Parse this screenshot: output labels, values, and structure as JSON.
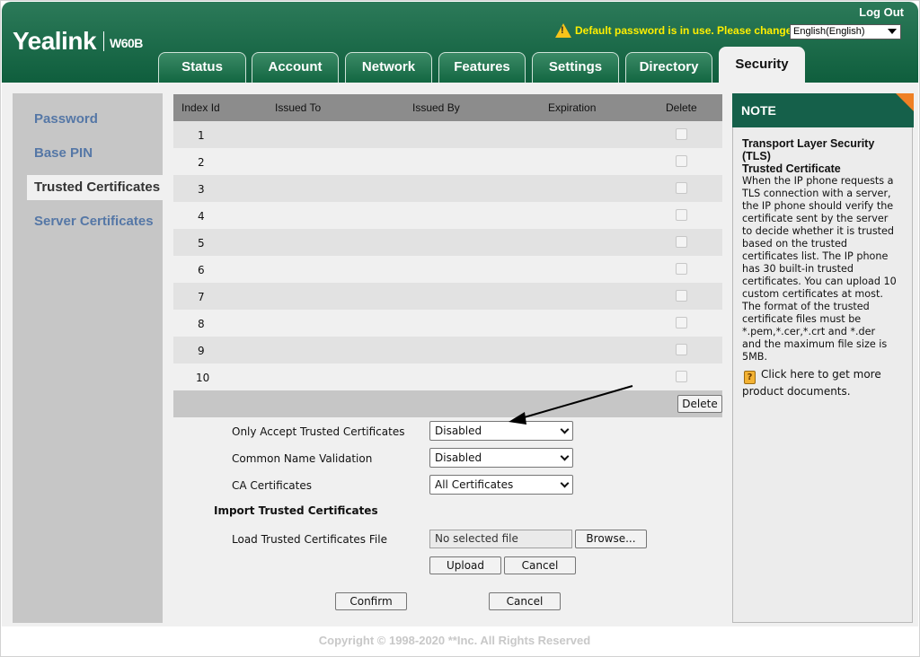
{
  "header": {
    "logo": "Yealink",
    "model": "W60B",
    "logout": "Log Out",
    "warning": "Default password is in use. Please change!",
    "language": "English(English)"
  },
  "tabs": [
    "Status",
    "Account",
    "Network",
    "Features",
    "Settings",
    "Directory",
    "Security"
  ],
  "active_tab": "Security",
  "sidebar": {
    "items": [
      "Password",
      "Base PIN",
      "Trusted Certificates",
      "Server Certificates"
    ],
    "active": "Trusted Certificates"
  },
  "cert_table": {
    "headers": [
      "Index Id",
      "Issued To",
      "Issued By",
      "Expiration",
      "Delete"
    ],
    "rows": [
      "1",
      "2",
      "3",
      "4",
      "5",
      "6",
      "7",
      "8",
      "9",
      "10"
    ],
    "delete_button": "Delete"
  },
  "settings": {
    "only_accept": {
      "label": "Only Accept Trusted Certificates",
      "value": "Disabled"
    },
    "common_name": {
      "label": "Common Name Validation",
      "value": "Disabled"
    },
    "ca_certs": {
      "label": "CA Certificates",
      "value": "All Certificates"
    },
    "import_title": "Import Trusted Certificates",
    "load_label": "Load Trusted Certificates File",
    "file_value": "No selected file",
    "browse": "Browse...",
    "upload": "Upload",
    "cancel_upload": "Cancel",
    "confirm": "Confirm",
    "cancel": "Cancel"
  },
  "note": {
    "heading": "NOTE",
    "title": "Transport Layer Security (TLS)",
    "subtitle": "Trusted Certificate",
    "body": "When the IP phone requests a TLS connection with a server, the IP phone should verify the certificate sent by the server to decide whether it is trusted based on the trusted certificates list. The IP phone has 30 built-in trusted certificates. You can upload 10 custom certificates at most. The format of the trusted certificate files must be *.pem,*.cer,*.crt and *.der and the maximum file size is 5MB.",
    "link": "Click here to get more product documents."
  },
  "copyright": "Copyright © 1998-2020 **Inc. All Rights Reserved",
  "colors": {
    "header_green": "#0f5e3d",
    "sidebar_link": "#5577a6",
    "warning_yellow": "#ffef00",
    "note_accent": "#ef8025"
  }
}
